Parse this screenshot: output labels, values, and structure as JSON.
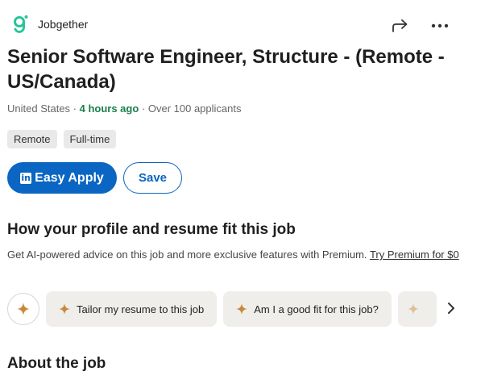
{
  "company": {
    "name": "Jobgether",
    "logo_icon": "jobgether-logo-icon",
    "brand_color": "#27c59a"
  },
  "header_actions": {
    "share_icon": "share-arrow-icon",
    "more_icon": "more-horizontal-icon"
  },
  "job": {
    "title": "Senior Software Engineer, Structure - (Remote - US/Canada)",
    "location": "United States",
    "posted": "4 hours ago",
    "applicants": "Over 100 applicants",
    "separator": " · "
  },
  "tags": [
    "Remote",
    "Full-time"
  ],
  "buttons": {
    "easy_apply": "Easy Apply",
    "easy_apply_logo": "in",
    "save": "Save",
    "accent": "#0a66c2"
  },
  "fit": {
    "heading": "How your profile and resume fit this job",
    "description": "Get AI-powered advice on this job and more exclusive features with Premium.",
    "premium_link": "Try Premium for $0"
  },
  "suggestions": {
    "icon": "sparkle-icon",
    "chips": [
      "Tailor my resume to this job",
      "Am I a good fit for this job?"
    ],
    "next_icon": "chevron-right-icon",
    "spark_color": "#c7883a"
  },
  "about": {
    "heading": "About the job"
  }
}
